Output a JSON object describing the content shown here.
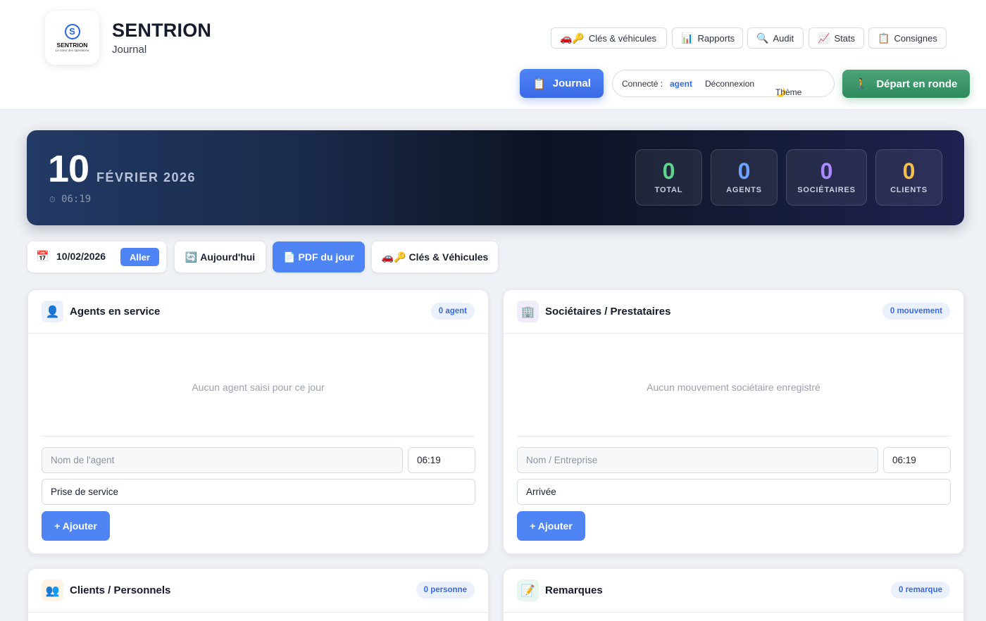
{
  "brand": {
    "logo_name": "SENTRION",
    "logo_tagline": "Le cœur des opérations",
    "title": "SENTRION",
    "subtitle": "Journal"
  },
  "nav": {
    "items": [
      {
        "icon": "🚗🔑",
        "label": "Clés & véhicules"
      },
      {
        "icon": "📊",
        "label": "Rapports"
      },
      {
        "icon": "🔍",
        "label": "Audit"
      },
      {
        "icon": "📈",
        "label": "Stats"
      },
      {
        "icon": "📋",
        "label": "Consignes"
      }
    ],
    "journal_icon": "📋",
    "journal_label": "Journal",
    "connected_label": "Connecté :",
    "user": "agent",
    "logout_label": "Déconnexion",
    "theme_icon": "🌙",
    "theme_label": "Thème",
    "ronde_icon": "🚶",
    "ronde_label": "Départ en ronde"
  },
  "hero": {
    "day": "10",
    "month_year": "FÉVRIER 2026",
    "clock_icon": "⏱",
    "time": "06:19",
    "stats": [
      {
        "value": "0",
        "label": "TOTAL",
        "color": "#5fd38f"
      },
      {
        "value": "0",
        "label": "AGENTS",
        "color": "#6ea2ff"
      },
      {
        "value": "0",
        "label": "SOCIÉTAIRES",
        "color": "#a98bff"
      },
      {
        "value": "0",
        "label": "CLIENTS",
        "color": "#f5c04a"
      }
    ]
  },
  "toolbar": {
    "calendar_icon": "📅",
    "date": "10/02/2026",
    "go_label": "Aller",
    "today_icon": "🔄",
    "today_label": "Aujourd'hui",
    "pdf_icon": "📄",
    "pdf_label": "PDF du jour",
    "keys_icon": "🚗🔑",
    "keys_label": "Clés & Véhicules"
  },
  "panels": {
    "agents": {
      "icon": "👤",
      "title": "Agents en service",
      "badge": "0 agent",
      "empty": "Aucun agent saisi pour ce jour",
      "name_placeholder": "Nom de l'agent",
      "time": "06:19",
      "type": "Prise de service",
      "add_label": "+ Ajouter"
    },
    "societaires": {
      "icon": "🏢",
      "title": "Sociétaires / Prestataires",
      "badge": "0 mouvement",
      "empty": "Aucun mouvement sociétaire enregistré",
      "name_placeholder": "Nom / Entreprise",
      "time": "06:19",
      "type": "Arrivée",
      "add_label": "+ Ajouter"
    },
    "clients": {
      "icon": "👥",
      "title": "Clients / Personnels",
      "badge": "0 personne"
    },
    "remarques": {
      "icon": "📝",
      "title": "Remarques",
      "badge": "0 remarque"
    }
  }
}
